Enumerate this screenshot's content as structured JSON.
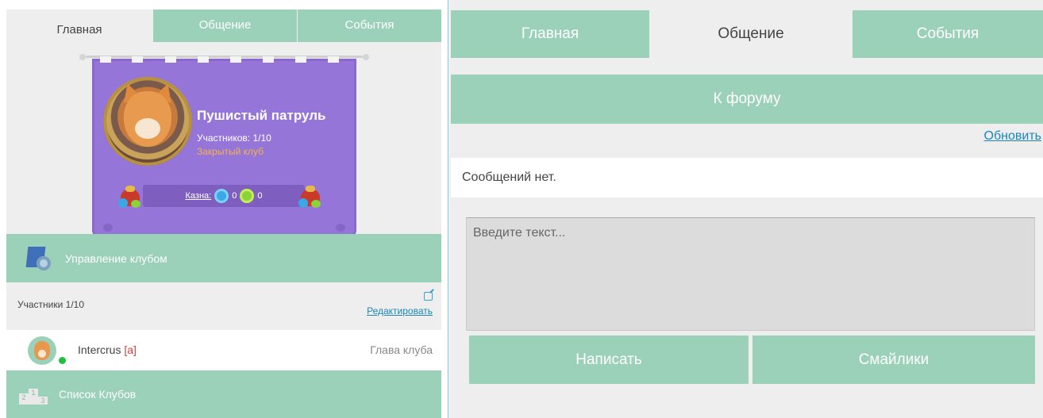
{
  "left": {
    "tabs": [
      {
        "label": "Главная",
        "active": true
      },
      {
        "label": "Общение",
        "active": false
      },
      {
        "label": "События",
        "active": false
      }
    ],
    "club": {
      "name": "Пушистый патруль",
      "members_text": "Участников: 1/10",
      "type_text": "Закрытый клуб",
      "treasury_label": "Казна:",
      "treasury_blue": "0",
      "treasury_green": "0"
    },
    "manage_label": "Управление клубом",
    "members_title": "Участники 1/10",
    "edit_label": "Редактировать",
    "member": {
      "name": "Intercrus",
      "tag": "[a]",
      "role": "Глава клуба",
      "online": true
    },
    "club_list_label": "Список Клубов"
  },
  "right": {
    "tabs": [
      {
        "label": "Главная",
        "active": false
      },
      {
        "label": "Общение",
        "active": true
      },
      {
        "label": "События",
        "active": false
      }
    ],
    "forum_button": "К форуму",
    "refresh_link": "Обновить",
    "no_messages": "Сообщений нет.",
    "input_placeholder": "Введите текст...",
    "send_button": "Написать",
    "smiles_button": "Смайлики"
  },
  "colors": {
    "accent_green": "#9bd1b9",
    "banner_purple": "#9575d8",
    "link_blue": "#1a85b8",
    "closed_orange": "#f2b24e",
    "online_green": "#1dc23a",
    "tag_red": "#d8403a"
  },
  "icons": [
    "club-emblem-icon",
    "coin-blue-icon",
    "coin-green-icon",
    "money-bag-icon",
    "club-management-icon",
    "edit-icon",
    "podium-icon",
    "avatar-icon"
  ]
}
